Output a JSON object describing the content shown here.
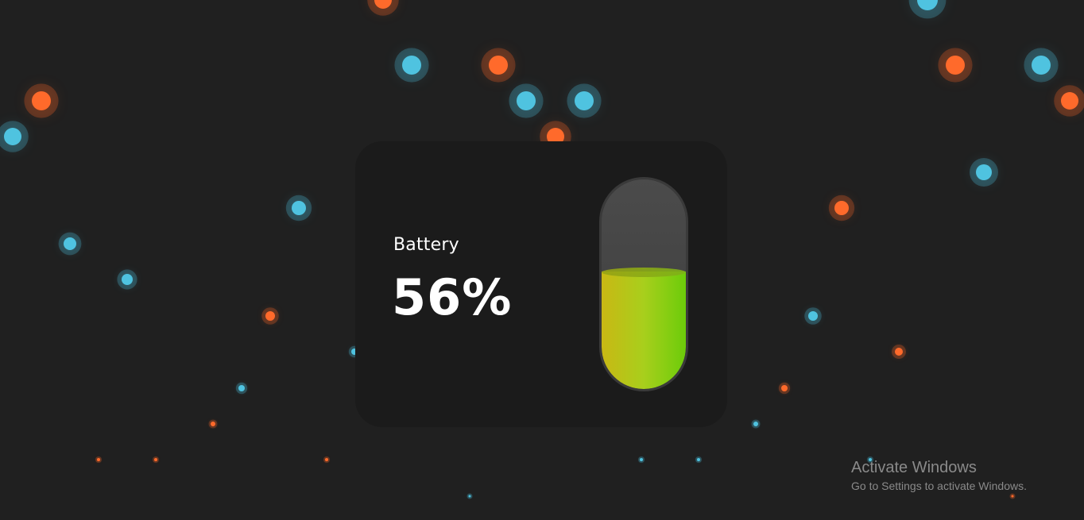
{
  "battery": {
    "label": "Battery",
    "percent_text": "56%",
    "level": 0.56
  },
  "watermark": {
    "title": "Activate Windows",
    "subtitle": "Go to Settings to activate Windows."
  },
  "colors": {
    "background": "#202020",
    "card": "#1b1b1b",
    "particle_orange": "#ff6a2b",
    "particle_blue": "#4fc3e0",
    "fill_start": "#c9b814",
    "fill_end": "#6ccc0a"
  }
}
